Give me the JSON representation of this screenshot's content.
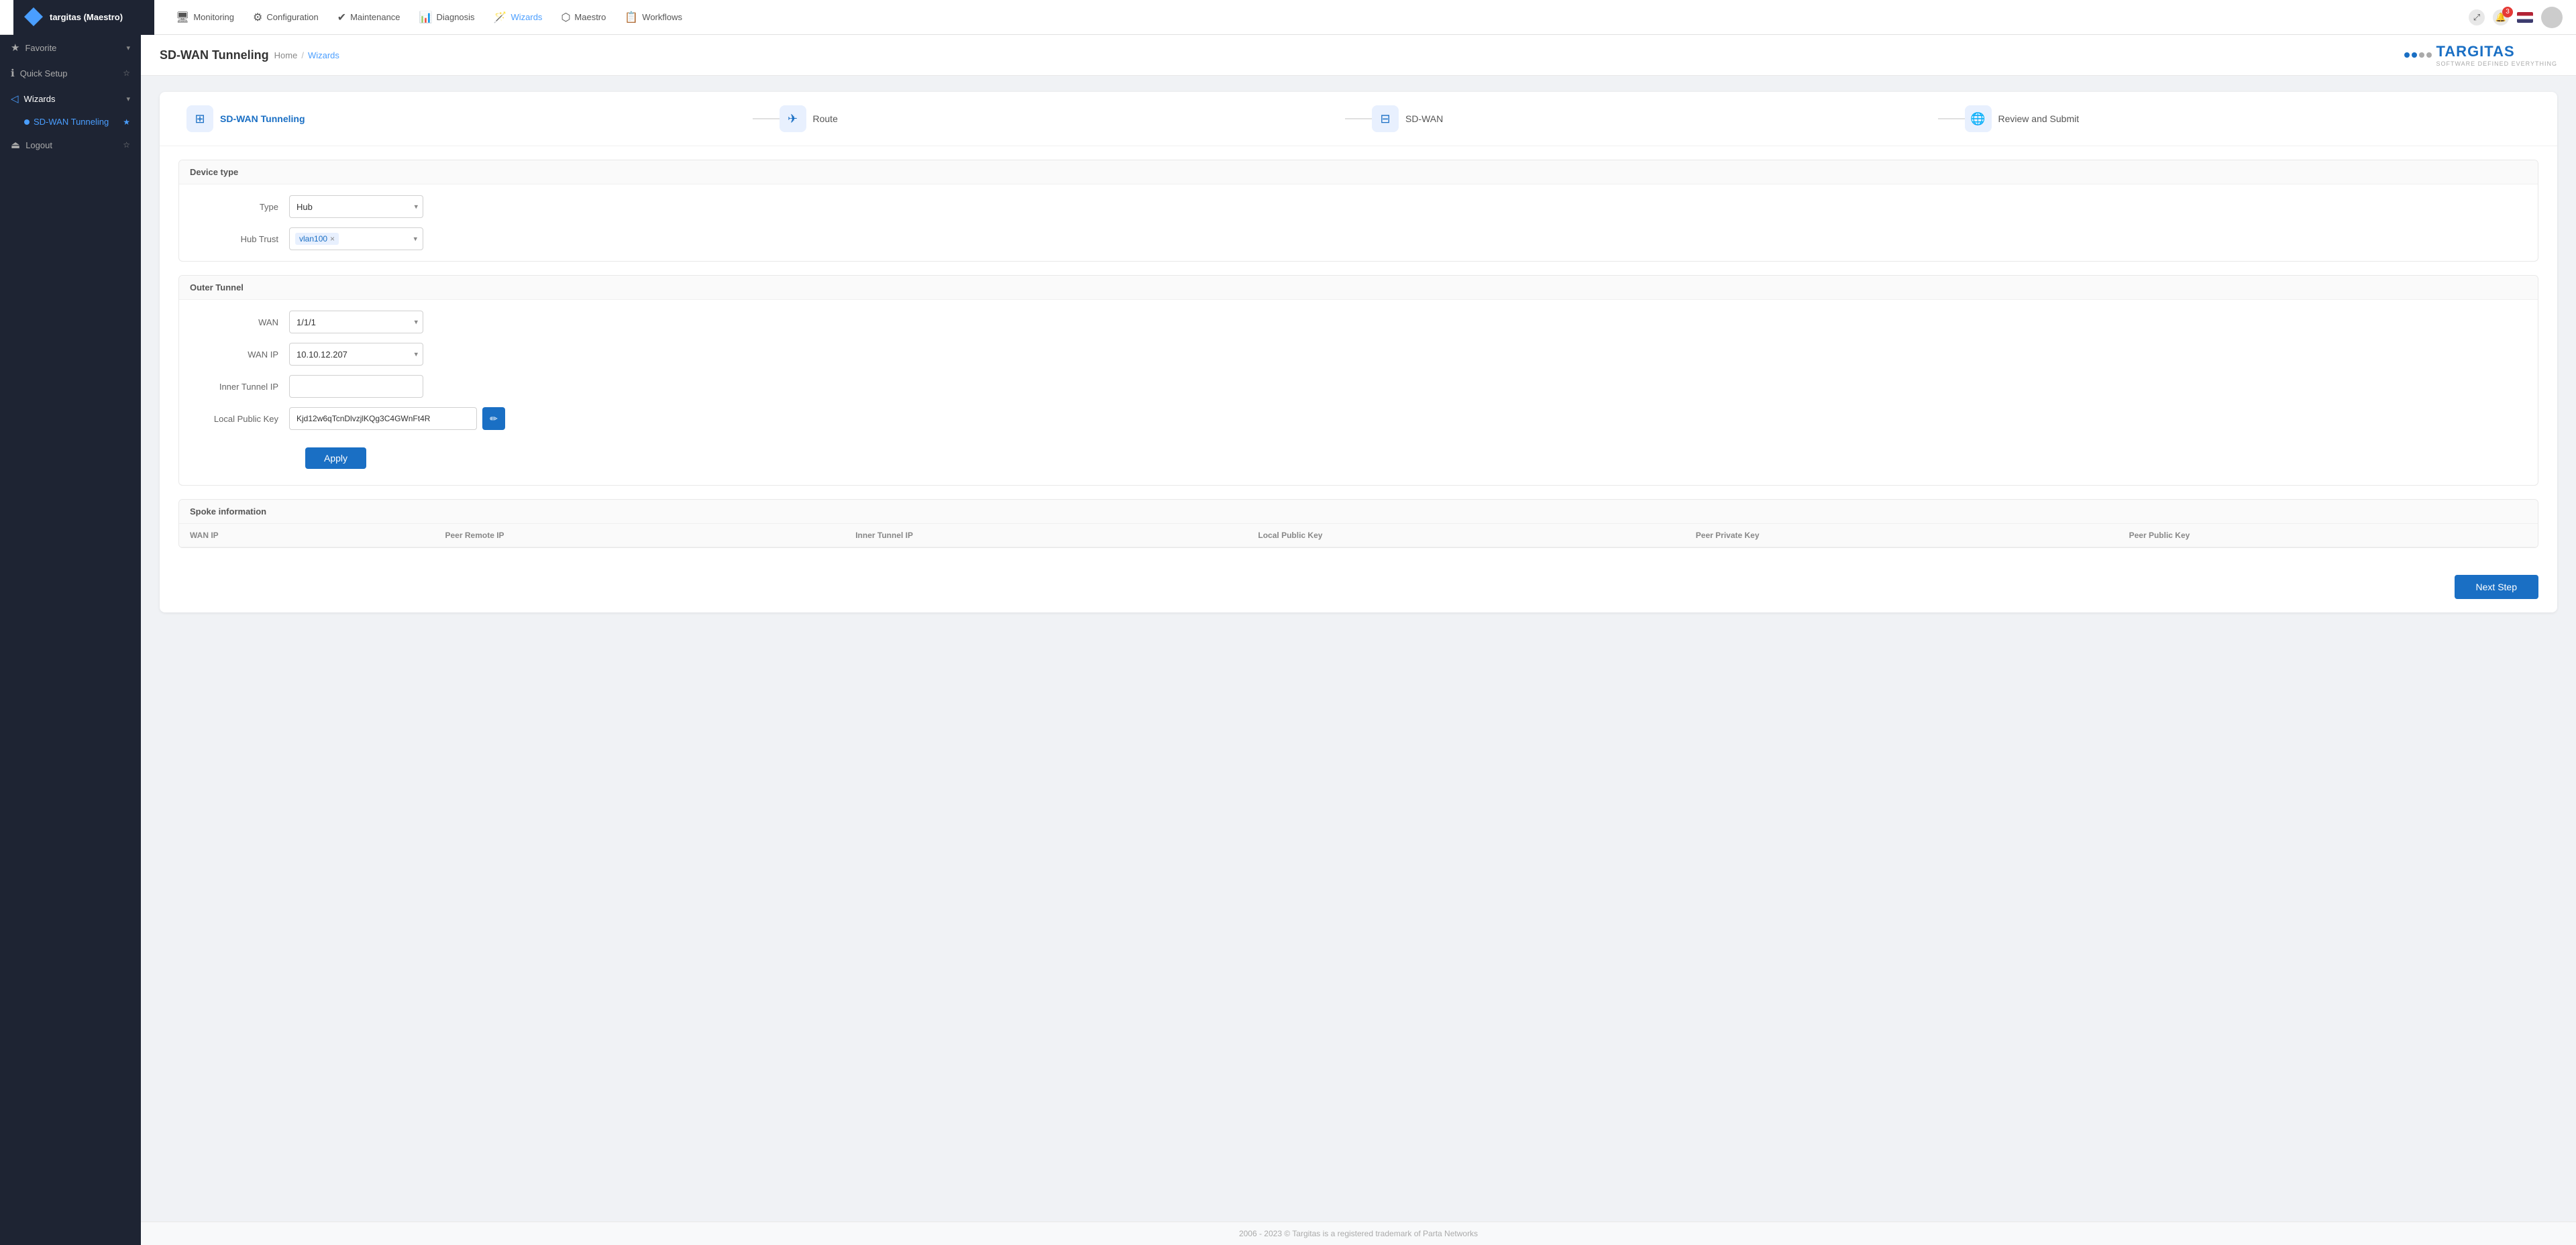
{
  "app": {
    "brand": "targitas (Maestro)",
    "logo_text": "TARGITAS",
    "logo_sub": "SOFTWARE DEFINED EVERYTHING"
  },
  "topbar": {
    "nav_items": [
      {
        "id": "monitoring",
        "label": "Monitoring",
        "icon": "🖥"
      },
      {
        "id": "configuration",
        "label": "Configuration",
        "icon": "⚙"
      },
      {
        "id": "maintenance",
        "label": "Maintenance",
        "icon": "✔"
      },
      {
        "id": "diagnosis",
        "label": "Diagnosis",
        "icon": "📊"
      },
      {
        "id": "wizards",
        "label": "Wizards",
        "icon": "🪄",
        "active": true
      },
      {
        "id": "maestro",
        "label": "Maestro",
        "icon": "⬡"
      },
      {
        "id": "workflows",
        "label": "Workflows",
        "icon": "📋"
      }
    ],
    "notification_count": "3"
  },
  "sidebar": {
    "items": [
      {
        "id": "favorite",
        "label": "Favorite",
        "icon": "★",
        "hasDropdown": true
      },
      {
        "id": "quick-setup",
        "label": "Quick Setup",
        "icon": "ℹ",
        "hasStar": true
      },
      {
        "id": "wizards",
        "label": "Wizards",
        "icon": "◁",
        "hasDropdown": true,
        "active": true
      },
      {
        "id": "sd-wan-tunneling",
        "label": "SD-WAN Tunneling",
        "sub": true,
        "active": true,
        "hasStar": true
      },
      {
        "id": "logout",
        "label": "Logout",
        "icon": "⏏",
        "hasStar": true
      }
    ]
  },
  "page": {
    "title": "SD-WAN Tunneling",
    "breadcrumb_home": "Home",
    "breadcrumb_sep": "/",
    "breadcrumb_current": "Wizards"
  },
  "wizard": {
    "steps": [
      {
        "id": "sd-wan-tunneling",
        "label": "SD-WAN Tunneling",
        "icon": "⊞",
        "active": true
      },
      {
        "id": "route",
        "label": "Route",
        "icon": "✈"
      },
      {
        "id": "sd-wan",
        "label": "SD-WAN",
        "icon": "⊟"
      },
      {
        "id": "review",
        "label": "Review and Submit",
        "icon": "🌐"
      }
    ]
  },
  "device_type": {
    "section_title": "Device type",
    "type_label": "Type",
    "type_value": "Hub",
    "hub_trust_label": "Hub Trust",
    "hub_trust_value": "vlan100"
  },
  "outer_tunnel": {
    "section_title": "Outer Tunnel",
    "wan_label": "WAN",
    "wan_value": "1/1/1",
    "wan_ip_label": "WAN IP",
    "wan_ip_value": "10.10.12.207",
    "inner_tunnel_ip_label": "Inner Tunnel IP",
    "inner_tunnel_ip_value": "",
    "local_public_key_label": "Local Public Key",
    "local_public_key_value": "Kjd12w6qTcnDlvzjlKQg3C4GWnFt4R",
    "apply_label": "Apply"
  },
  "spoke_info": {
    "section_title": "Spoke information",
    "columns": [
      "WAN IP",
      "Peer Remote IP",
      "Inner Tunnel IP",
      "Local Public Key",
      "Peer Private Key",
      "Peer Public Key"
    ]
  },
  "footer": {
    "text": "2006 - 2023 © Targitas is a registered trademark of Parta Networks"
  },
  "next_step": {
    "label": "Next Step"
  }
}
